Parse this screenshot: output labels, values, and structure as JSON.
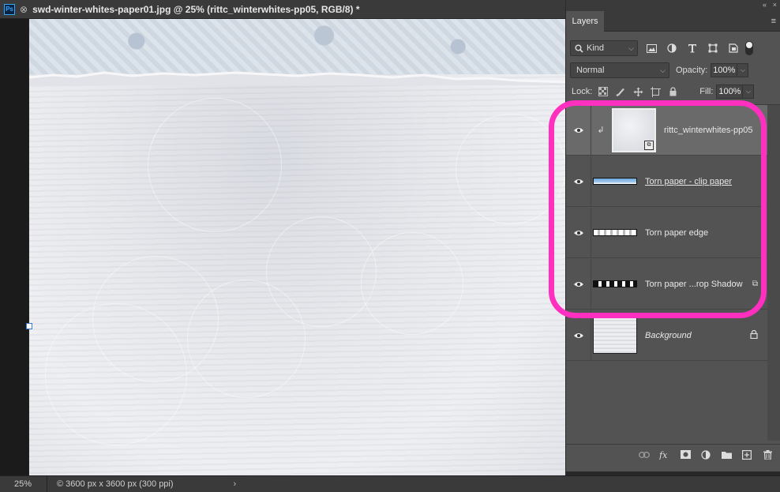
{
  "document": {
    "close_glyph": "⊗",
    "title": "swd-winter-whites-paper01.jpg @ 25% (rittc_winterwhites-pp05, RGB/8) *",
    "app_icon": "Ps"
  },
  "status": {
    "zoom": "25%",
    "info": "© 3600 px x 3600 px (300 ppi)",
    "arrow": "›"
  },
  "panel": {
    "collapse_glyph": "«",
    "close_glyph": "×",
    "tab_label": "Layers",
    "menu_glyph": "≡",
    "filter": {
      "kind_label": "Kind",
      "chevron": "⌵"
    },
    "blend": {
      "mode": "Normal",
      "chevron": "⌵"
    },
    "opacity": {
      "label": "Opacity:",
      "value": "100%",
      "chevron": "⌵"
    },
    "lock": {
      "label": "Lock:"
    },
    "fill": {
      "label": "Fill:",
      "value": "100%",
      "chevron": "⌵"
    },
    "layers": [
      {
        "name": "rittc_winterwhites-pp05",
        "selected": true,
        "clip_glyph": "↲",
        "badge": "⧉"
      },
      {
        "name": "Torn paper - clip paper"
      },
      {
        "name": "Torn paper edge"
      },
      {
        "name": "Torn paper ...rop Shadow",
        "end_icon": "⧉"
      },
      {
        "name": "Background",
        "end_icon": "🔒"
      }
    ]
  },
  "colors": {
    "highlight": "#ff2fc0",
    "panel_bg": "#535353",
    "selected_layer": "#6a6a6a"
  },
  "icons": {
    "filter": [
      "image-filter-icon",
      "adjustment-filter-icon",
      "type-filter-icon",
      "shape-filter-icon",
      "smart-object-filter-icon"
    ],
    "lock": [
      "lock-transparent-icon",
      "lock-image-icon",
      "lock-position-icon",
      "lock-artboard-icon",
      "lock-all-icon"
    ],
    "footer": [
      "link-layers-icon",
      "fx-icon",
      "layer-mask-icon",
      "adjustment-layer-icon",
      "group-folder-icon",
      "new-layer-icon",
      "delete-layer-icon"
    ]
  }
}
